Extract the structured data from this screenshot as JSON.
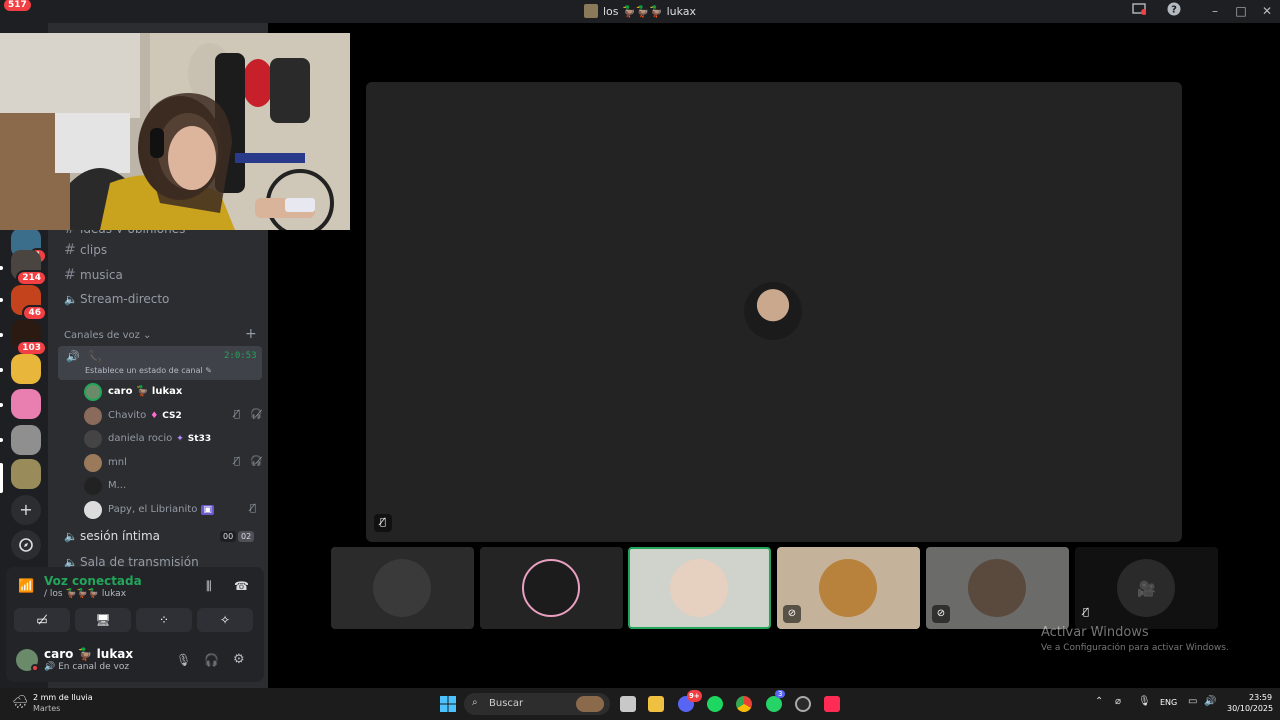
{
  "window": {
    "title": "los 🦆🦆🦆 lukax"
  },
  "titlebar": {
    "notif_badge": "517"
  },
  "servers": {
    "badges": [
      "1",
      "214",
      "46",
      "103"
    ]
  },
  "channels": {
    "partial_top": "ideas-y-opiniones",
    "text": [
      "clips",
      "musica"
    ],
    "stream": "Stream-directo",
    "voice_section": "Canales de voz",
    "active_voice": {
      "timer": "2:0:53",
      "status_hint": "Establece un estado de canal"
    },
    "other_voice": [
      {
        "label": "sesión íntima",
        "counts": [
          "00",
          "02"
        ]
      },
      {
        "label": "Sala de transmisión"
      }
    ]
  },
  "members": [
    {
      "name": "caro 🦆 lukax",
      "tag": "",
      "self": true
    },
    {
      "name": "Chavito",
      "tag": "CS2"
    },
    {
      "name": "daniela rocio",
      "tag": "St33"
    },
    {
      "name": "mnl",
      "tag": ""
    },
    {
      "name": "M...",
      "tag": ""
    },
    {
      "name": "Papy, el Librianito",
      "tag": ""
    }
  ],
  "voice_panel": {
    "status": "Voz conectada",
    "channel": "/ los 🦆🦆🦆 lukax"
  },
  "user": {
    "name": "caro 🦆 lukax",
    "status": "En canal de voz"
  },
  "watermark": {
    "line1": "Activar Windows",
    "line2": "Ve a Configuración para activar Windows."
  },
  "taskbar": {
    "weather": "2 mm de lluvia",
    "weather_sub": "Martes",
    "search_placeholder": "Buscar",
    "lang": "ENG",
    "time": "23:59",
    "date": "30/10/2025",
    "discord_badge": "9+",
    "whatsapp_badge": "3"
  },
  "colors": {
    "green": "#23a55a",
    "red": "#f23f43",
    "bg": "#000000"
  }
}
